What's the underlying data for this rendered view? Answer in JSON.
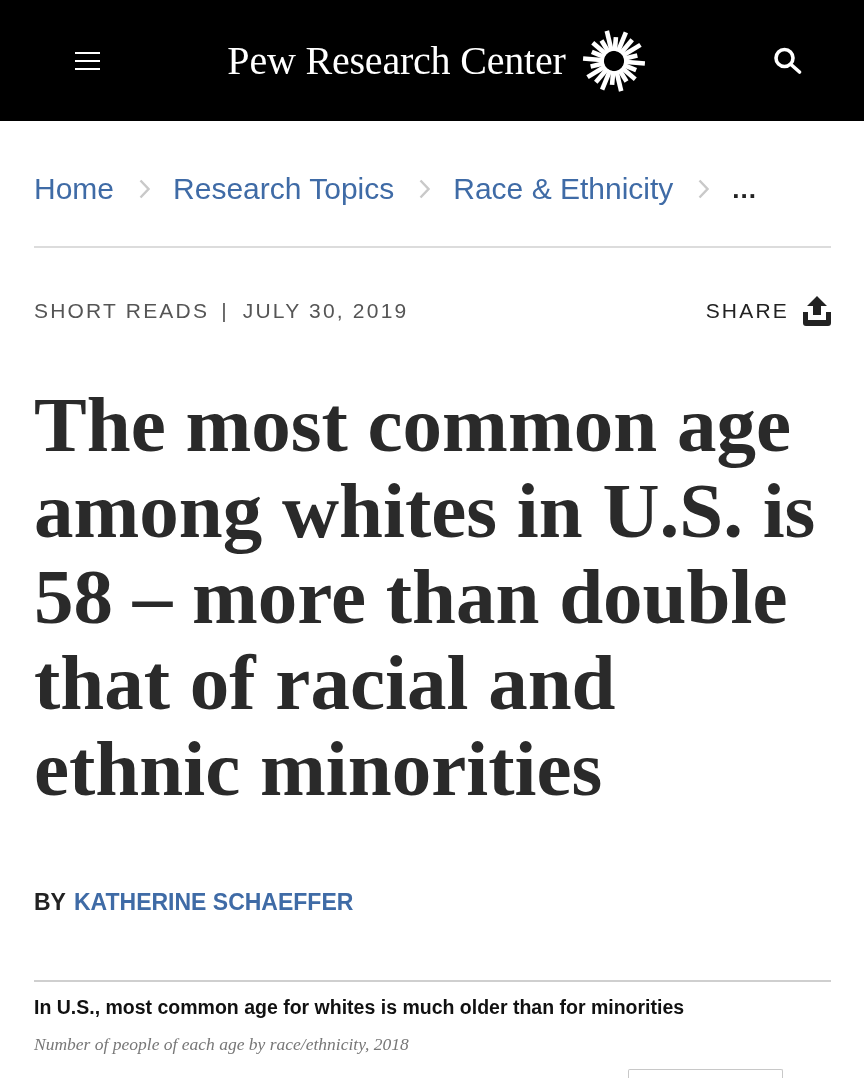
{
  "header": {
    "logo_text": "Pew Research Center"
  },
  "breadcrumbs": [
    {
      "label": "Home"
    },
    {
      "label": "Research Topics"
    },
    {
      "label": "Race & Ethnicity"
    }
  ],
  "breadcrumb_more": "...",
  "meta": {
    "category": "SHORT READS",
    "separator": "|",
    "date": "JULY 30, 2019",
    "share": "SHARE"
  },
  "headline": "The most common age among whites in U.S. is 58 – more than double that of racial and ethnic minorities",
  "byline": {
    "prefix": "BY",
    "author": "KATHERINE SCHAEFFER"
  },
  "chart": {
    "title": "In U.S., most common age for whites is much older than for minorities",
    "subtitle": "Number of people of each age by race/ethnicity, 2018"
  }
}
